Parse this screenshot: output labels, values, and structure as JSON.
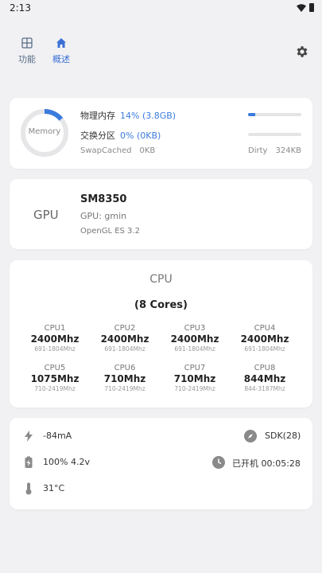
{
  "statusbar": {
    "time": "2:13"
  },
  "nav": {
    "tabs": [
      {
        "label": "功能",
        "icon": "grid-icon"
      },
      {
        "label": "概述",
        "icon": "home-icon"
      }
    ],
    "settings_icon": "gear-icon",
    "accent": "#3b6fd6"
  },
  "memory": {
    "ring_label": "Memory",
    "ring_percent": 14,
    "physical_label": "物理内存",
    "physical_value": "14% (3.8GB)",
    "physical_fraction": 0.14,
    "swap_label": "交换分区",
    "swap_value": "0% (0KB)",
    "swap_fraction": 0,
    "swapcached_label": "SwapCached",
    "swapcached_value": "0KB",
    "dirty_label": "Dirty",
    "dirty_value": "324KB"
  },
  "gpu": {
    "label": "GPU",
    "model": "SM8350",
    "name_line": "GPU: gmin",
    "api_line": "OpenGL ES 3.2"
  },
  "cpu": {
    "title": "CPU",
    "cores_label": "(8 Cores)",
    "cores": [
      {
        "name": "CPU1",
        "freq": "2400Mhz",
        "range": "691-1804Mhz"
      },
      {
        "name": "CPU2",
        "freq": "2400Mhz",
        "range": "691-1804Mhz"
      },
      {
        "name": "CPU3",
        "freq": "2400Mhz",
        "range": "691-1804Mhz"
      },
      {
        "name": "CPU4",
        "freq": "2400Mhz",
        "range": "691-1804Mhz"
      },
      {
        "name": "CPU5",
        "freq": "1075Mhz",
        "range": "710-2419Mhz"
      },
      {
        "name": "CPU6",
        "freq": "710Mhz",
        "range": "710-2419Mhz"
      },
      {
        "name": "CPU7",
        "freq": "710Mhz",
        "range": "710-2419Mhz"
      },
      {
        "name": "CPU8",
        "freq": "844Mhz",
        "range": "844-3187Mhz"
      }
    ]
  },
  "status": {
    "current": "-84mA",
    "sdk": "SDK(28)",
    "battery": "100% 4.2v",
    "uptime": "已开机 00:05:28",
    "temperature": "31°C"
  }
}
